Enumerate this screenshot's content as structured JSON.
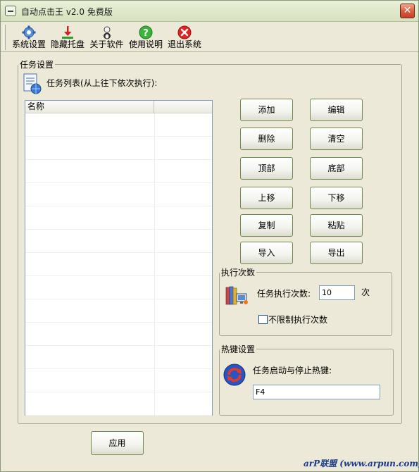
{
  "window": {
    "title": "自动点击王 v2.0 免费版",
    "close_glyph": "✕"
  },
  "toolbar": [
    {
      "label": "系统设置",
      "icon": "settings-gear-icon"
    },
    {
      "label": "隐藏托盘",
      "icon": "download-tray-icon"
    },
    {
      "label": "关于软件",
      "icon": "person-about-icon"
    },
    {
      "label": "使用说明",
      "icon": "help-question-icon"
    },
    {
      "label": "退出系统",
      "icon": "exit-close-icon"
    }
  ],
  "task_group": {
    "title": "任务设置",
    "list_caption": "任务列表(从上往下依次执行):",
    "list_icon": "document-globe-icon",
    "columns": [
      "名称",
      ""
    ],
    "rows": []
  },
  "buttons": {
    "add": "添加",
    "edit": "编辑",
    "delete": "删除",
    "clear": "清空",
    "top": "顶部",
    "bottom": "底部",
    "move_up": "上移",
    "move_down": "下移",
    "copy": "复制",
    "paste": "粘贴",
    "import": "导入",
    "export": "导出",
    "apply": "应用"
  },
  "exec_group": {
    "title": "执行次数",
    "icon": "books-computer-icon",
    "count_label": "任务执行次数:",
    "count_value": "10",
    "unit": "次",
    "unlimited_label": "不限制执行次数",
    "unlimited_checked": false
  },
  "hotkey_group": {
    "title": "热键设置",
    "icon": "refresh-arrows-icon",
    "label": "任务启动与停止热键:",
    "value": "F4"
  },
  "watermark": "arP联盟 (www.arpun.com)",
  "colors": {
    "window_bg": "#ECE9D8",
    "button_border": "#6E8A4C",
    "close_red": "#D95A3A"
  }
}
